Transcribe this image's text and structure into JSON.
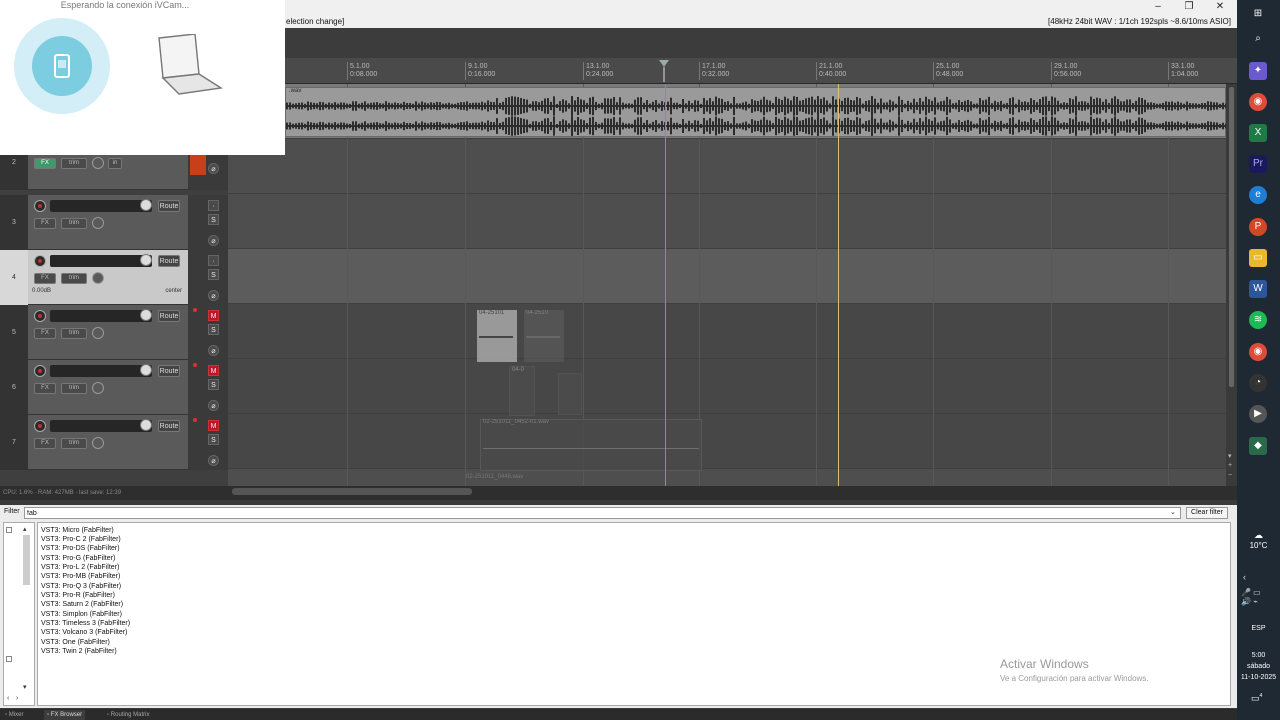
{
  "titlebar": {
    "left_text": "election change]",
    "right_text": "[48kHz 24bit WAV : 1/1ch 192spls ~8.6/10ms ASIO]",
    "min_icon": "minimize-icon",
    "restore_icon": "restore-icon",
    "close_icon": "close-icon"
  },
  "ruler": {
    "marks": [
      {
        "bar": "5.1.00",
        "time": "0:08.000"
      },
      {
        "bar": "9.1.00",
        "time": "0:16.000"
      },
      {
        "bar": "13.1.00",
        "time": "0:24.000"
      },
      {
        "bar": "17.1.00",
        "time": "0:32.000"
      },
      {
        "bar": "21.1.00",
        "time": "0:40.000"
      },
      {
        "bar": "25.1.00",
        "time": "0:48.000"
      },
      {
        "bar": "29.1.00",
        "time": "0:56.000"
      },
      {
        "bar": "33.1.00",
        "time": "1:04.000"
      }
    ]
  },
  "arrange": {
    "top_item_name": ".wav",
    "item_a": "04-25101",
    "item_b": "04-2510",
    "item_c": "04-0",
    "item_d": "02-251011_0452-01.wav",
    "item_e": "02-251011_0448.wav"
  },
  "tracks": [
    {
      "num": "2",
      "fx": "FX",
      "trim": "trim",
      "in": "in"
    },
    {
      "num": "3",
      "route": "Route",
      "fx": "FX",
      "trim": "trim"
    },
    {
      "num": "4",
      "route": "Route",
      "fx": "FX",
      "trim": "trim",
      "volume": "0.00dB",
      "pan": "center",
      "selected": true
    },
    {
      "num": "5",
      "route": "Route",
      "fx": "FX",
      "trim": "trim",
      "muted": true
    },
    {
      "num": "6",
      "route": "Route",
      "fx": "FX",
      "trim": "trim",
      "muted": true
    },
    {
      "num": "7",
      "route": "Route",
      "fx": "FX",
      "trim": "trim",
      "muted": true
    }
  ],
  "ms_labels": {
    "m": "M",
    "s": "S"
  },
  "status": "CPU: 1.6% · RAM: 427MB · last save: 12:39",
  "fxbrowser": {
    "filter_label": "Filter",
    "filter_value": "fab",
    "clear_label": "Clear filter",
    "plugins": [
      "VST3: Micro (FabFilter)",
      "VST3: Pro-C 2 (FabFilter)",
      "VST3: Pro-DS (FabFilter)",
      "VST3: Pro-G (FabFilter)",
      "VST3: Pro-L 2 (FabFilter)",
      "VST3: Pro-MB (FabFilter)",
      "VST3: Pro-Q 3 (FabFilter)",
      "VST3: Pro-R (FabFilter)",
      "VST3: Saturn 2 (FabFilter)",
      "VST3: Simplon (FabFilter)",
      "VST3: Timeless 3 (FabFilter)",
      "VST3: Volcano 3 (FabFilter)",
      "VST3: One (FabFilter)",
      "VST3: Twin 2 (FabFilter)"
    ]
  },
  "activate": {
    "line1": "Activar Windows",
    "line2": "Ve a Configuración para activar Windows."
  },
  "tabs": [
    {
      "label": "Mixer",
      "active": false
    },
    {
      "label": "FX Browser",
      "active": true
    },
    {
      "label": "Routing Matrix",
      "active": false
    }
  ],
  "ivcam": {
    "text": "Esperando la conexión iVCam..."
  },
  "taskbar": {
    "weather_temp": "10°C",
    "lang": "ESP",
    "time": "5:00",
    "day": "sábado",
    "date": "11-10-2025",
    "notif_count": "4"
  },
  "colors": {
    "mute_on": "#b8182a",
    "playcursor": "#2fb9a0",
    "editcursor": "#d8c070"
  }
}
